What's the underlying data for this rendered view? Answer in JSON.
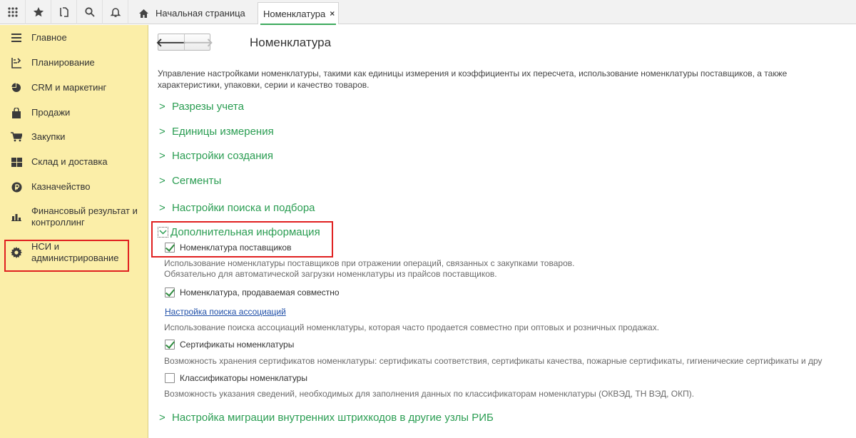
{
  "topbar": {
    "icons": [
      "apps-grid-icon",
      "star-icon",
      "history-icon",
      "search-icon",
      "bell-icon"
    ],
    "tabs": [
      {
        "label": "Начальная страница",
        "icon": "home-icon",
        "active": false
      },
      {
        "label": "Номенклатура",
        "active": true,
        "close": "×"
      }
    ]
  },
  "sidebar": {
    "bg_color": "#fbeea8",
    "items": [
      {
        "label": "Главное",
        "icon": "menu-lines-icon"
      },
      {
        "label": "Планирование",
        "icon": "planning-icon"
      },
      {
        "label": "CRM и маркетинг",
        "icon": "pie-chart-icon"
      },
      {
        "label": "Продажи",
        "icon": "shopping-bag-icon"
      },
      {
        "label": "Закупки",
        "icon": "cart-icon"
      },
      {
        "label": "Склад и доставка",
        "icon": "warehouse-grid-icon"
      },
      {
        "label": "Казначейство",
        "icon": "ruble-coin-icon"
      },
      {
        "label": "Финансовый результат и контроллинг",
        "icon": "bar-chart-icon"
      },
      {
        "label": "НСИ и администрирование",
        "icon": "gear-icon",
        "highlighted": true
      }
    ]
  },
  "main": {
    "nav": {
      "back": "🡐",
      "forward": "🡒"
    },
    "title": "Номенклатура",
    "intro": "Управление настройками номенклатуры, такими как единицы измерения и коэффициенты их пересчета, использование номенклатуры поставщиков, а также характеристики, упаковки, серии и качество товаров.",
    "sections": [
      {
        "label": "Разрезы учета",
        "expanded": false
      },
      {
        "label": "Единицы измерения",
        "expanded": false
      },
      {
        "label": "Настройки создания",
        "expanded": false
      },
      {
        "label": "Сегменты",
        "expanded": false
      },
      {
        "label": "Настройки поиска и подбора",
        "expanded": false
      },
      {
        "label": "Дополнительная информация",
        "expanded": true
      },
      {
        "label": "Настройка миграции внутренних штрихкодов в другие узлы РИБ",
        "expanded": false
      }
    ],
    "options": {
      "supplier_nom": {
        "label": "Номенклатура поставщиков",
        "checked": true,
        "desc1": "Использование номенклатуры поставщиков при отражении операций, связанных с закупками товаров.",
        "desc2": "Обязательно для автоматической загрузки номенклатуры из прайсов поставщиков."
      },
      "sold_together": {
        "label": "Номенклатура, продаваемая совместно",
        "checked": true,
        "link": "Настройка поиска ассоциаций",
        "desc": "Использование поиска ассоциаций номенклатуры, которая часто продается совместно при оптовых и розничных продажах."
      },
      "certificates": {
        "label": "Сертификаты номенклатуры",
        "checked": true,
        "desc": "Возможность хранения сертификатов номенклатуры: сертификаты соответствия, сертификаты качества, пожарные сертификаты, гигиенические сертификаты и дру"
      },
      "classifiers": {
        "label": "Классификаторы номенклатуры",
        "checked": false,
        "desc": "Возможность указания сведений, необходимых для заполнения данных по классификаторам номенклатуры (ОКВЭД, ТН ВЭД, ОКП)."
      }
    }
  },
  "colors": {
    "accent_green": "#2a9d52",
    "highlight_red": "#e02020",
    "link_blue": "#1f4fa8"
  }
}
